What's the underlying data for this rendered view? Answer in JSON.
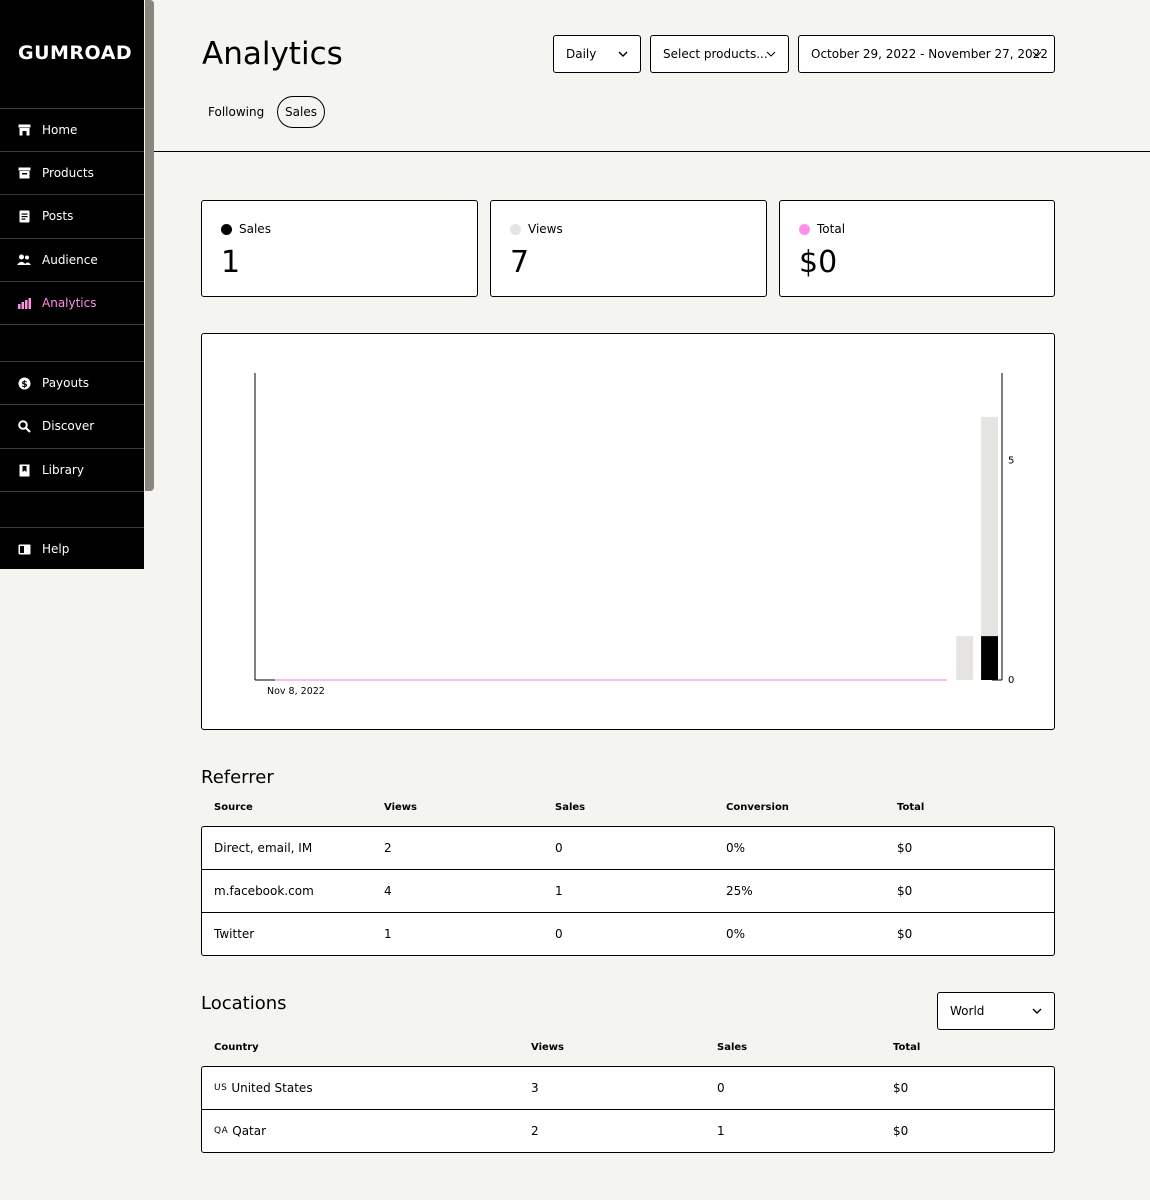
{
  "sidebar": {
    "logo": "GUMROAD",
    "items": [
      {
        "label": "Home",
        "icon": "store-icon"
      },
      {
        "label": "Products",
        "icon": "archive-icon"
      },
      {
        "label": "Posts",
        "icon": "document-icon"
      },
      {
        "label": "Audience",
        "icon": "people-icon"
      },
      {
        "label": "Analytics",
        "icon": "bar-chart-icon",
        "active": true
      },
      {
        "label": "Payouts",
        "icon": "dollar-circle-icon"
      },
      {
        "label": "Discover",
        "icon": "search-icon"
      },
      {
        "label": "Library",
        "icon": "bookmark-icon"
      },
      {
        "label": "Help",
        "icon": "book-icon"
      }
    ]
  },
  "header": {
    "title": "Analytics",
    "interval": "Daily",
    "products_placeholder": "Select products...",
    "date_range": "October 29, 2022 - November 27, 2022",
    "tabs": [
      "Following",
      "Sales"
    ],
    "active_tab": "Sales"
  },
  "stats": [
    {
      "label": "Sales",
      "value": "1",
      "color": "#000000"
    },
    {
      "label": "Views",
      "value": "7",
      "color": "#e5e4e1"
    },
    {
      "label": "Total",
      "value": "$0",
      "color": "#ff90e8"
    }
  ],
  "chart_data": {
    "type": "bar",
    "x_tick_label": "Nov 8, 2022",
    "y_ticks": [
      "5",
      "0"
    ],
    "ylim": [
      0,
      7
    ],
    "grid": false,
    "series": [
      {
        "name": "Views",
        "color": "#e5e4e1",
        "points": [
          {
            "day_index": 28,
            "value": 1
          },
          {
            "day_index": 29,
            "value": 6
          }
        ]
      },
      {
        "name": "Sales",
        "color": "#000000",
        "points": [
          {
            "day_index": 29,
            "value": 1
          }
        ]
      },
      {
        "name": "Total",
        "color": "#ff90e8",
        "type": "line",
        "value": 0
      }
    ]
  },
  "referrer": {
    "title": "Referrer",
    "columns": [
      "Source",
      "Views",
      "Sales",
      "Conversion",
      "Total"
    ],
    "rows": [
      [
        "Direct, email, IM",
        "2",
        "0",
        "0%",
        "$0"
      ],
      [
        "m.facebook.com",
        "4",
        "1",
        "25%",
        "$0"
      ],
      [
        "Twitter",
        "1",
        "0",
        "0%",
        "$0"
      ]
    ]
  },
  "locations": {
    "title": "Locations",
    "region": "World",
    "columns": [
      "Country",
      "Views",
      "Sales",
      "Total"
    ],
    "rows": [
      {
        "code": "US",
        "country": "United States",
        "views": "3",
        "sales": "0",
        "total": "$0"
      },
      {
        "code": "QA",
        "country": "Qatar",
        "views": "2",
        "sales": "1",
        "total": "$0"
      }
    ]
  }
}
